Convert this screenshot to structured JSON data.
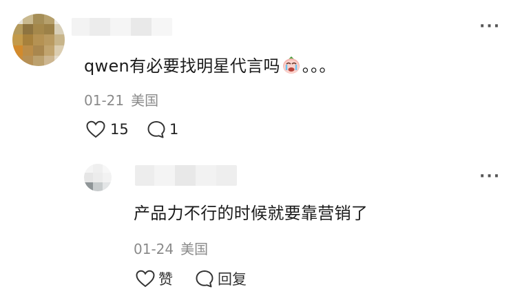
{
  "comments": [
    {
      "text_prefix": "qwen有必要找明星代言吗",
      "emoji": "loudly-crying-face",
      "text_suffix": "。。。",
      "date": "01-21",
      "location": "美国",
      "like_count": "15",
      "reply_count": "1"
    }
  ],
  "replies": [
    {
      "text": "产品力不行的时候就要靠营销了",
      "date": "01-24",
      "location": "美国",
      "like_label": "赞",
      "reply_label": "回复"
    }
  ],
  "more_glyph": "···",
  "colors": {
    "text": "#1b1b1b",
    "meta": "#8a8a8a",
    "icon": "#333333"
  }
}
